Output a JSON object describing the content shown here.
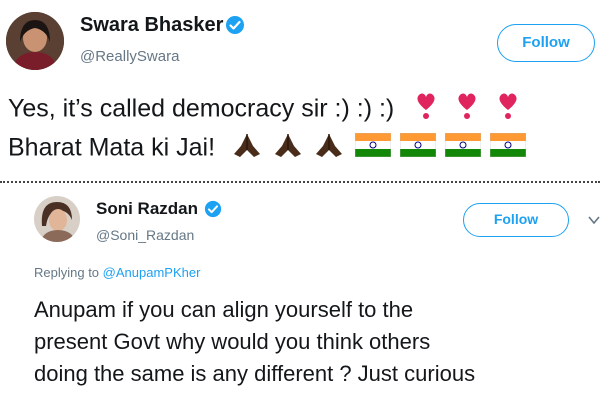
{
  "tweet1": {
    "author_name": "Swara Bhasker",
    "author_handle": "@ReallySwara",
    "follow_label": "Follow",
    "line1": "Yes, it’s called democracy sir :) :) :)",
    "line2": "Bharat Mata ki Jai!",
    "verified_icon": "verified-badge-icon",
    "heart_color": "#e0245e"
  },
  "tweet2": {
    "author_name": "Soni Razdan",
    "author_handle": "@Soni_Razdan",
    "follow_label": "Follow",
    "replying_prefix": "Replying to",
    "replying_to": "@AnupamPKher",
    "line1": "Anupam if you can align yourself to the",
    "line2": "present Govt why would you think others",
    "line3": "doing the same is any different ? Just curious",
    "verified_icon": "verified-badge-icon",
    "more_icon": "chevron-down-icon"
  },
  "colors": {
    "accent": "#1da1f2",
    "handle": "#657786",
    "text": "#14171a"
  }
}
